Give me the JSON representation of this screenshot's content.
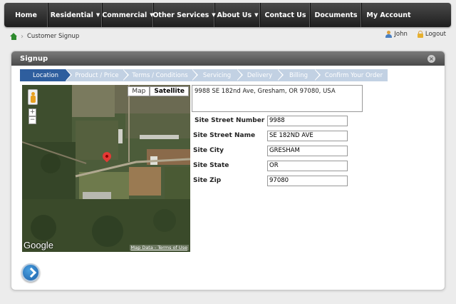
{
  "nav": {
    "items": [
      {
        "label": "Home",
        "dropdown": false
      },
      {
        "label": "Residential",
        "dropdown": true
      },
      {
        "label": "Commercial",
        "dropdown": true
      },
      {
        "label": "Other Services",
        "dropdown": true
      },
      {
        "label": "About Us",
        "dropdown": true
      },
      {
        "label": "Contact Us",
        "dropdown": false
      },
      {
        "label": "Documents",
        "dropdown": false
      },
      {
        "label": "My Account",
        "dropdown": false
      }
    ]
  },
  "breadcrumb": {
    "current": "Customer Signup"
  },
  "user": {
    "name": "John",
    "logout_label": "Logout"
  },
  "panel": {
    "title": "Signup"
  },
  "steps": [
    {
      "label": "Location",
      "active": true
    },
    {
      "label": "Product / Price",
      "active": false
    },
    {
      "label": "Terms / Conditions",
      "active": false
    },
    {
      "label": "Servicing",
      "active": false
    },
    {
      "label": "Delivery",
      "active": false
    },
    {
      "label": "Billing",
      "active": false
    },
    {
      "label": "Confirm Your Order",
      "active": false
    }
  ],
  "map": {
    "type_map_label": "Map",
    "type_satellite_label": "Satellite",
    "selected_type": "Satellite",
    "zoom_in": "+",
    "zoom_out": "−",
    "logo": "Google",
    "terms": "Map Data - Terms of Use"
  },
  "address": {
    "full": "9988 SE 182nd Ave, Gresham, OR 97080, USA"
  },
  "form": {
    "street_number": {
      "label": "Site Street Number",
      "value": "9988"
    },
    "street_name": {
      "label": "Site Street Name",
      "value": "SE 182ND AVE"
    },
    "city": {
      "label": "Site City",
      "value": "GRESHAM"
    },
    "state": {
      "label": "Site State",
      "value": "OR"
    },
    "zip": {
      "label": "Site Zip",
      "value": "97080"
    }
  },
  "colors": {
    "nav_bg": "#2a2a2a",
    "step_active": "#2e5e9e",
    "step_inactive": "#c2d1e3",
    "panel_header": "#5a5a5a",
    "next_button": "#1a5ea8"
  },
  "icons": {
    "home": "home-icon",
    "user": "user-icon",
    "logout": "lock-icon",
    "close": "close-icon",
    "info": "info-icon",
    "next": "chevron-right-icon"
  }
}
